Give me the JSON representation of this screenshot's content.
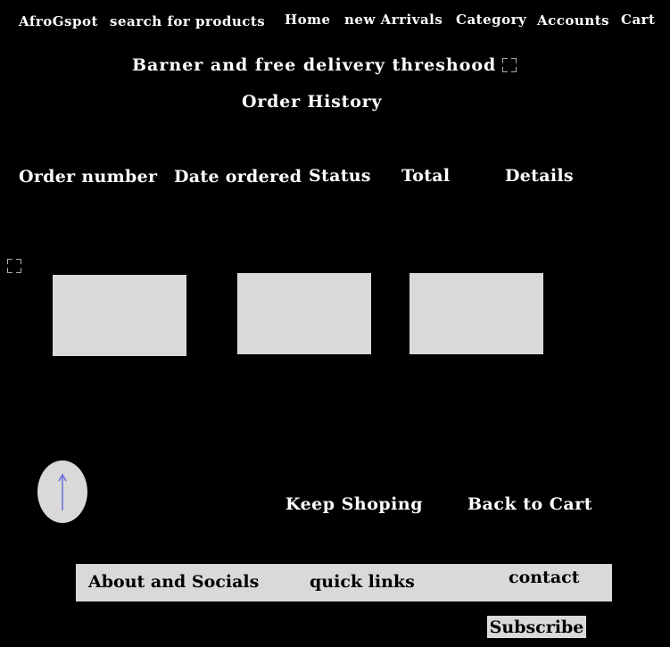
{
  "nav": {
    "brand": "AfroGspot",
    "search_placeholder": "search for products",
    "home": "Home",
    "new_arrivals": "new Arrivals",
    "category": "Category",
    "accounts": "Accounts",
    "cart": "Cart"
  },
  "banner": {
    "text": "Barner and free delivery threshood"
  },
  "page": {
    "title": "Order History"
  },
  "table": {
    "headers": [
      "Order number",
      "Date ordered",
      "Status",
      "Total",
      "Details"
    ]
  },
  "actions": {
    "keep_shopping": "Keep Shoping",
    "back_to_cart": "Back to Cart"
  },
  "footer": {
    "about": "About and Socials",
    "quick_links": "quick links",
    "contact": "contact",
    "subscribe": "Subscribe"
  },
  "icons": {
    "banner_icon": "frame-icon",
    "side_icon": "frame-icon",
    "scroll_top": "arrow-up-icon"
  },
  "colors": {
    "background": "#000000",
    "text": "#ffffff",
    "panel": "#d9d9d9",
    "arrow": "#6b6bd6"
  }
}
